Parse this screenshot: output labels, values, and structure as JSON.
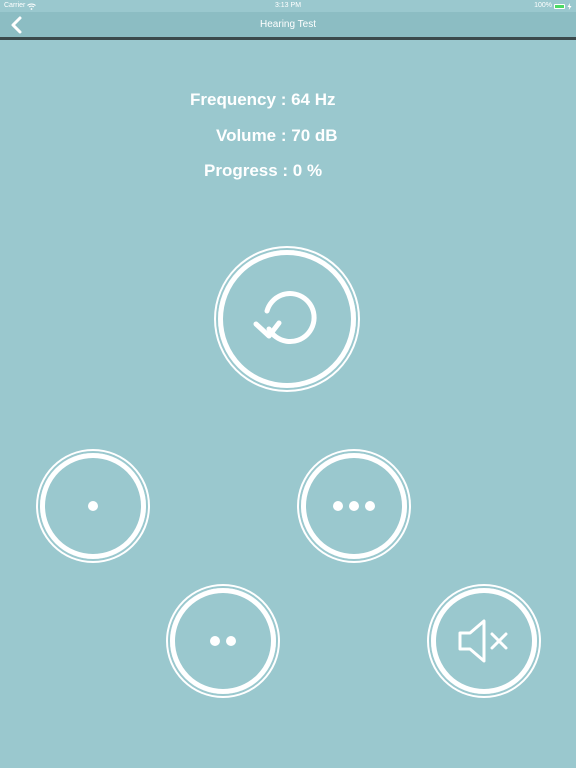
{
  "status_bar": {
    "carrier": "Carrier",
    "time": "3:13 PM",
    "battery_text": "100%",
    "battery_level": 1.0,
    "wifi_icon": "wifi-icon",
    "battery_icon": "battery-icon",
    "charging_icon": "charging-bolt-icon"
  },
  "nav": {
    "title": "Hearing Test",
    "back_icon": "chevron-left-icon"
  },
  "info": {
    "frequency": "Frequency : 64 Hz",
    "volume": "Volume : 70 dB",
    "progress": "Progress : 0 %"
  },
  "buttons": {
    "replay_icon": "replay-icon",
    "one_tone_icon": "one-dot-icon",
    "two_tones_icon": "two-dots-icon",
    "three_tones_icon": "three-dots-icon",
    "no_sound_icon": "speaker-muted-icon"
  },
  "colors": {
    "background": "#9ac8ce",
    "nav_bar": "#8cbdc3",
    "nav_border": "#3b4a4c",
    "foreground": "#ffffff",
    "battery_fill": "#4cd964"
  }
}
